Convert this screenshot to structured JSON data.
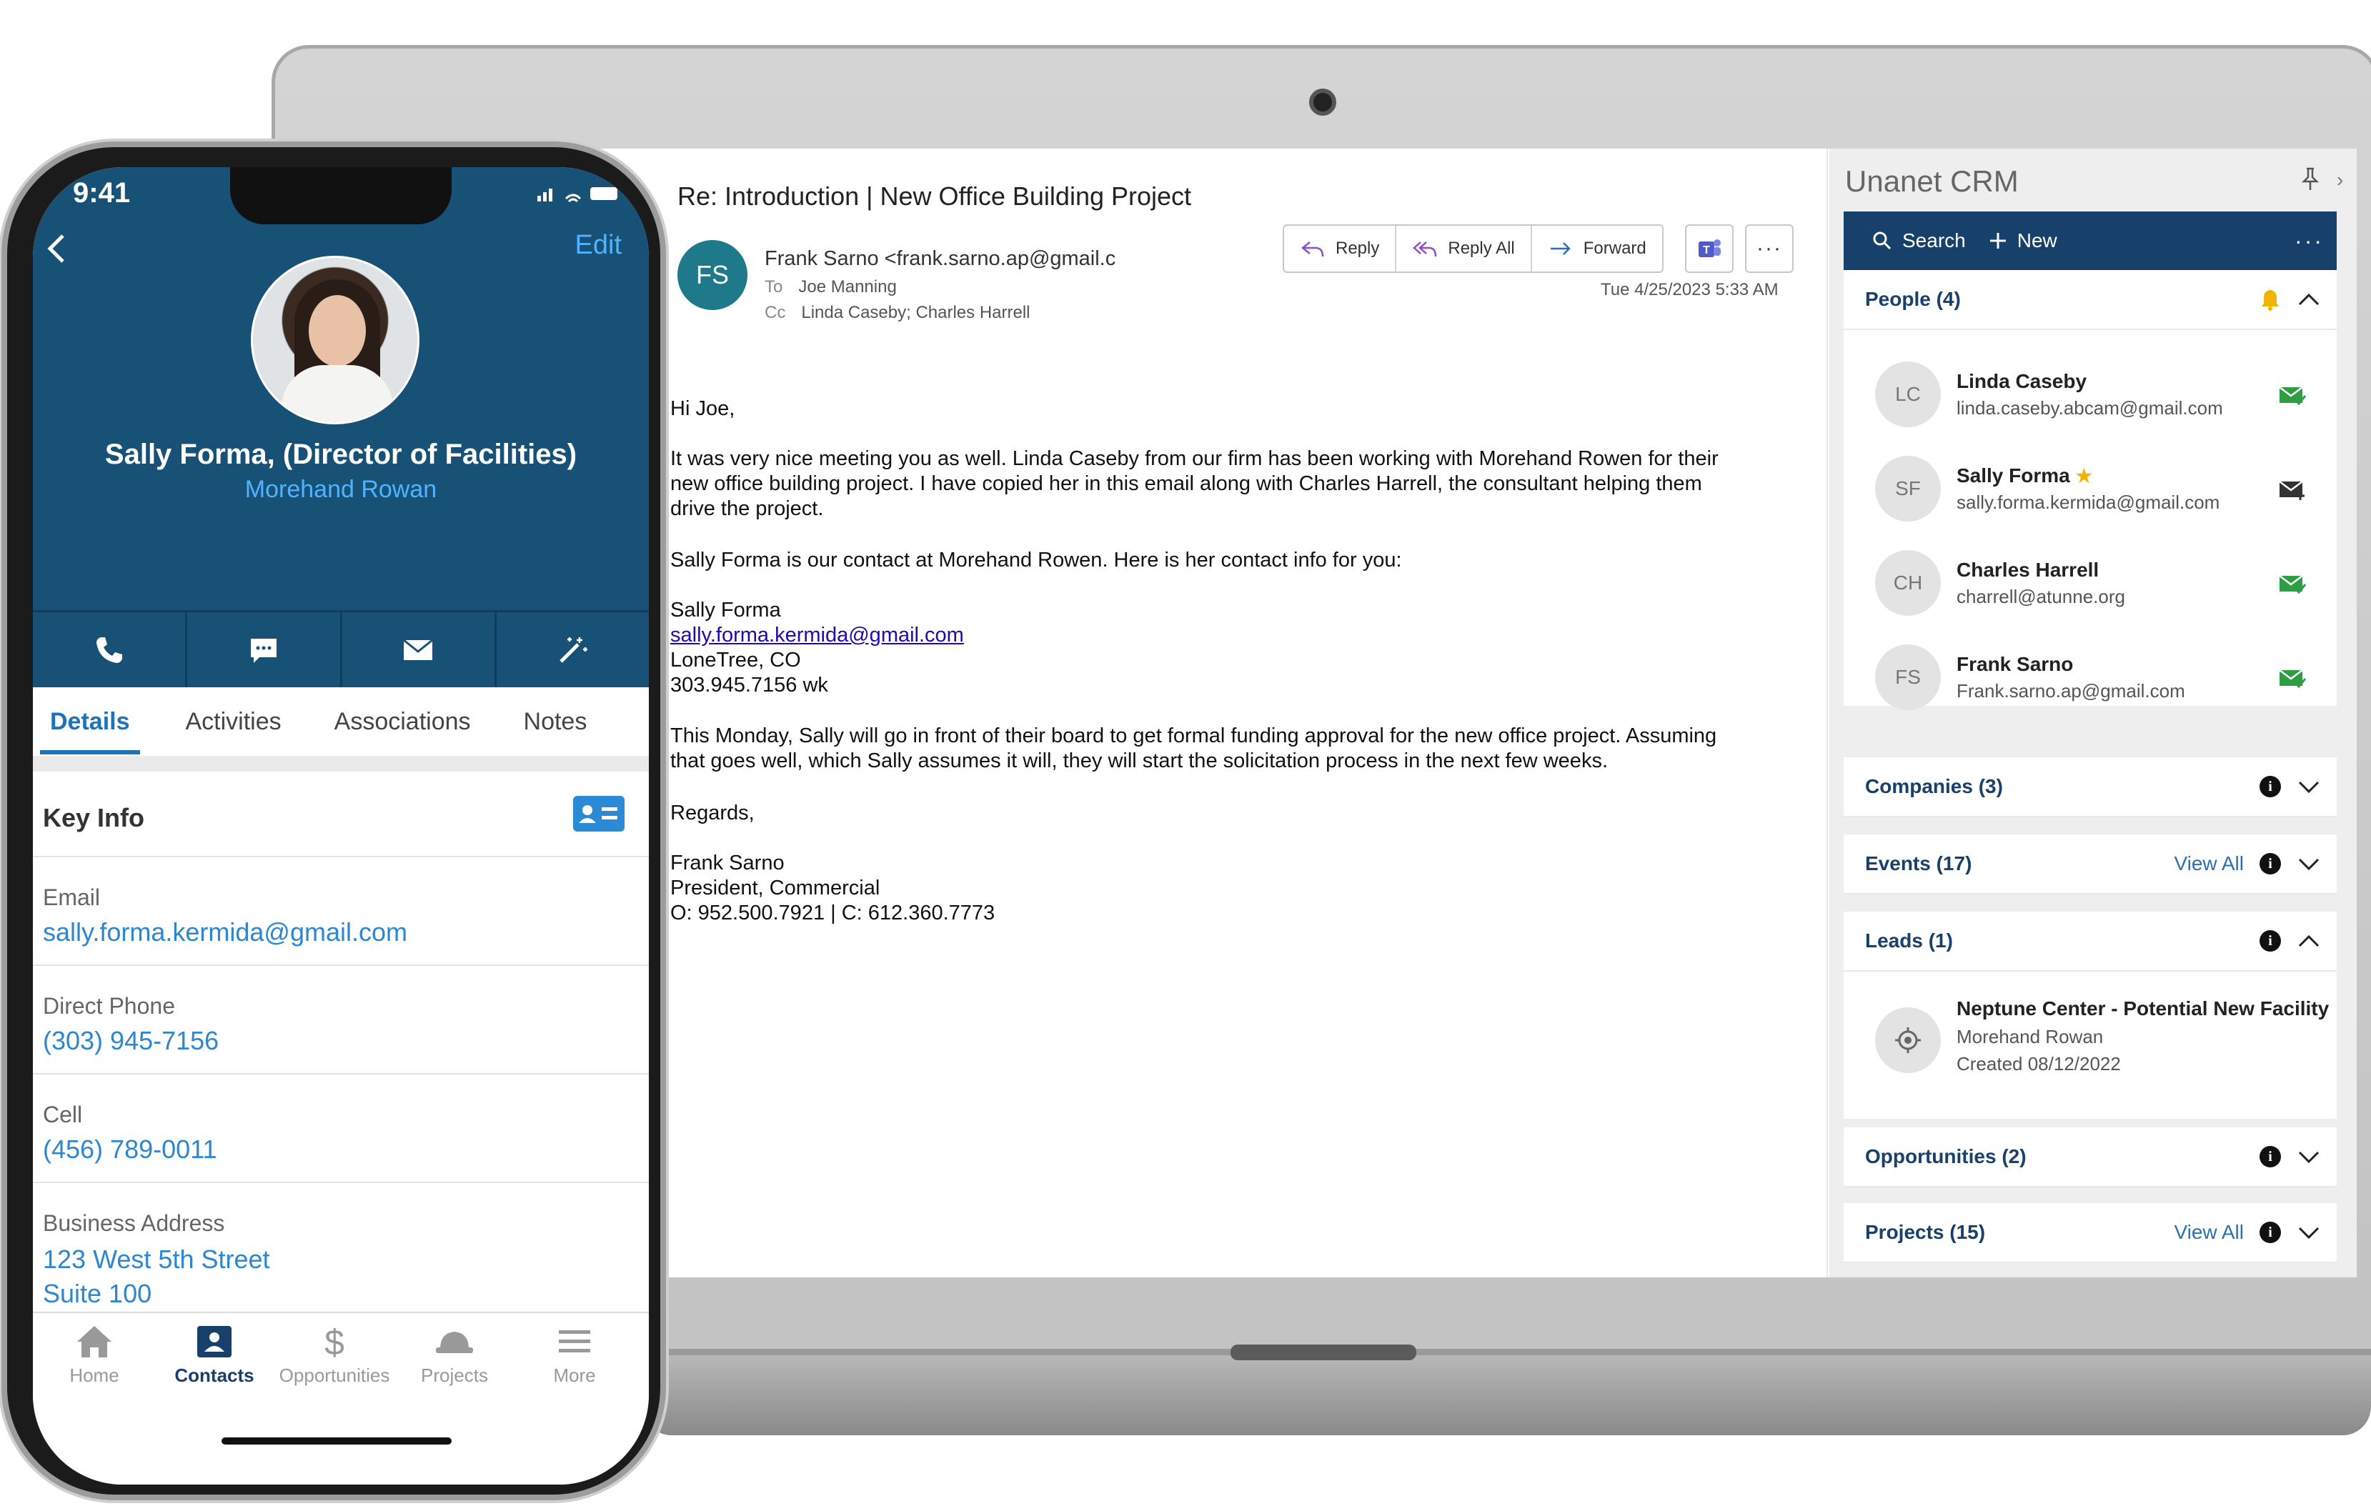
{
  "email": {
    "subject": "Re: Introduction | New Office Building Project",
    "sender_initials": "FS",
    "sender": "Frank Sarno <frank.sarno.ap@gmail.c",
    "to_label": "To",
    "to": "Joe Manning",
    "cc_label": "Cc",
    "cc": "Linda Caseby; Charles Harrell",
    "date": "Tue 4/25/2023 5:33 AM",
    "actions": {
      "reply": "Reply",
      "reply_all": "Reply All",
      "forward": "Forward",
      "more": "···"
    },
    "body": {
      "l1": "Hi Joe,",
      "l2": "It was very nice meeting you as well. Linda Caseby from our firm has been working with Morehand Rowen for their",
      "l3": "new office building project. I have copied her in this email along with Charles Harrell, the consultant helping them",
      "l4": "drive the project.",
      "l5": "Sally Forma is our contact at Morehand Rowen. Here is her contact info for you:",
      "l6": "Sally Forma",
      "l7": "sally.forma.kermida@gmail.com",
      "l8": "LoneTree, CO",
      "l9": "303.945.7156 wk",
      "l10": "This Monday, Sally will go in front of their board to get formal funding approval for the new office project.  Assuming",
      "l11": "that goes well, which Sally assumes it will, they will start the solicitation process in the next few weeks.",
      "l12": "Regards,",
      "l13": "Frank Sarno",
      "l14": "President, Commercial",
      "l15": "O: 952.500.7921 | C: 612.360.7773"
    }
  },
  "crm": {
    "title": "Unanet CRM",
    "search": "Search",
    "new": "New",
    "people": {
      "header": "People (4)",
      "items": [
        {
          "initials": "LC",
          "name": "Linda Caseby",
          "email": "linda.caseby.abcam@gmail.com"
        },
        {
          "initials": "SF",
          "name": "Sally Forma",
          "email": "sally.forma.kermida@gmail.com"
        },
        {
          "initials": "CH",
          "name": "Charles Harrell",
          "email": "charrell@atunne.org"
        },
        {
          "initials": "FS",
          "name": "Frank Sarno",
          "email": "Frank.sarno.ap@gmail.com"
        }
      ]
    },
    "companies": "Companies (3)",
    "events": "Events (17)",
    "view_all": "View All",
    "leads": {
      "header": "Leads (1)",
      "name": "Neptune Center - Potential New Facility",
      "company": "Morehand Rowan",
      "created": "Created 08/12/2022"
    },
    "opportunities": "Opportunities (2)",
    "projects": "Projects (15)"
  },
  "phone": {
    "time": "9:41",
    "edit": "Edit",
    "name": "Sally Forma, (Director of Facilities)",
    "company": "Morehand Rowan",
    "tabs": [
      "Details",
      "Activities",
      "Associations",
      "Notes"
    ],
    "key_info": "Key Info",
    "fields": {
      "email_label": "Email",
      "email": "sally.forma.kermida@gmail.com",
      "direct_label": "Direct Phone",
      "direct": "(303) 945-7156",
      "cell_label": "Cell",
      "cell": "(456) 789-0011",
      "address_label": "Business Address",
      "address1": "123 West 5th Street",
      "address2": "Suite 100"
    },
    "tabbar": [
      "Home",
      "Contacts",
      "Opportunities",
      "Projects",
      "More"
    ]
  },
  "colors": {
    "crm_navy": "#17406a",
    "phone_header": "#175176",
    "link_blue": "#2c86d0",
    "email_green": "#2e9e44",
    "star": "#f0b400"
  }
}
